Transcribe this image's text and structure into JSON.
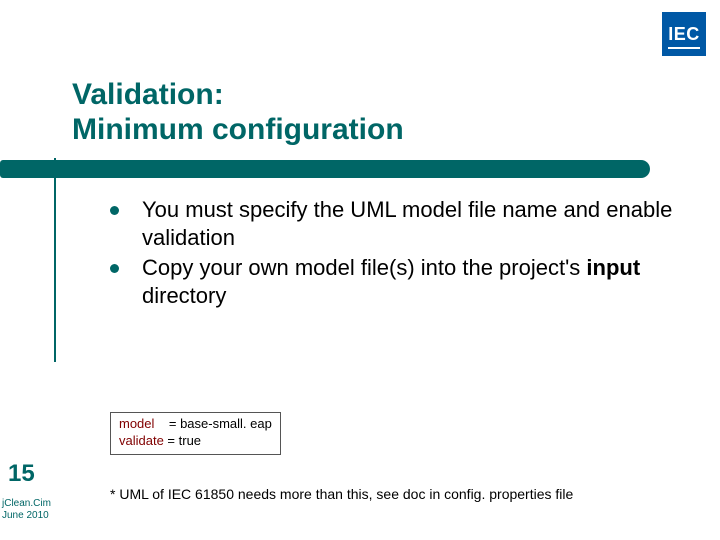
{
  "logo": {
    "text": "IEC"
  },
  "title": {
    "line1": "Validation:",
    "line2": "Minimum configuration"
  },
  "bullets": [
    {
      "text": "You must specify the UML model file name and enable validation"
    },
    {
      "text_pre": "Copy your own model file(s) into the project's ",
      "bold": "input",
      "text_post": " directory"
    }
  ],
  "config": {
    "rows": [
      {
        "key": "model   ",
        "val": " = base-small. eap"
      },
      {
        "key": "validate",
        "val": " = true"
      }
    ]
  },
  "slide_number": "15",
  "footer": {
    "line1": "jClean.Cim",
    "line2": "June 2010"
  },
  "footnote": "* UML of IEC 61850 needs more than this, see doc in config. properties file"
}
